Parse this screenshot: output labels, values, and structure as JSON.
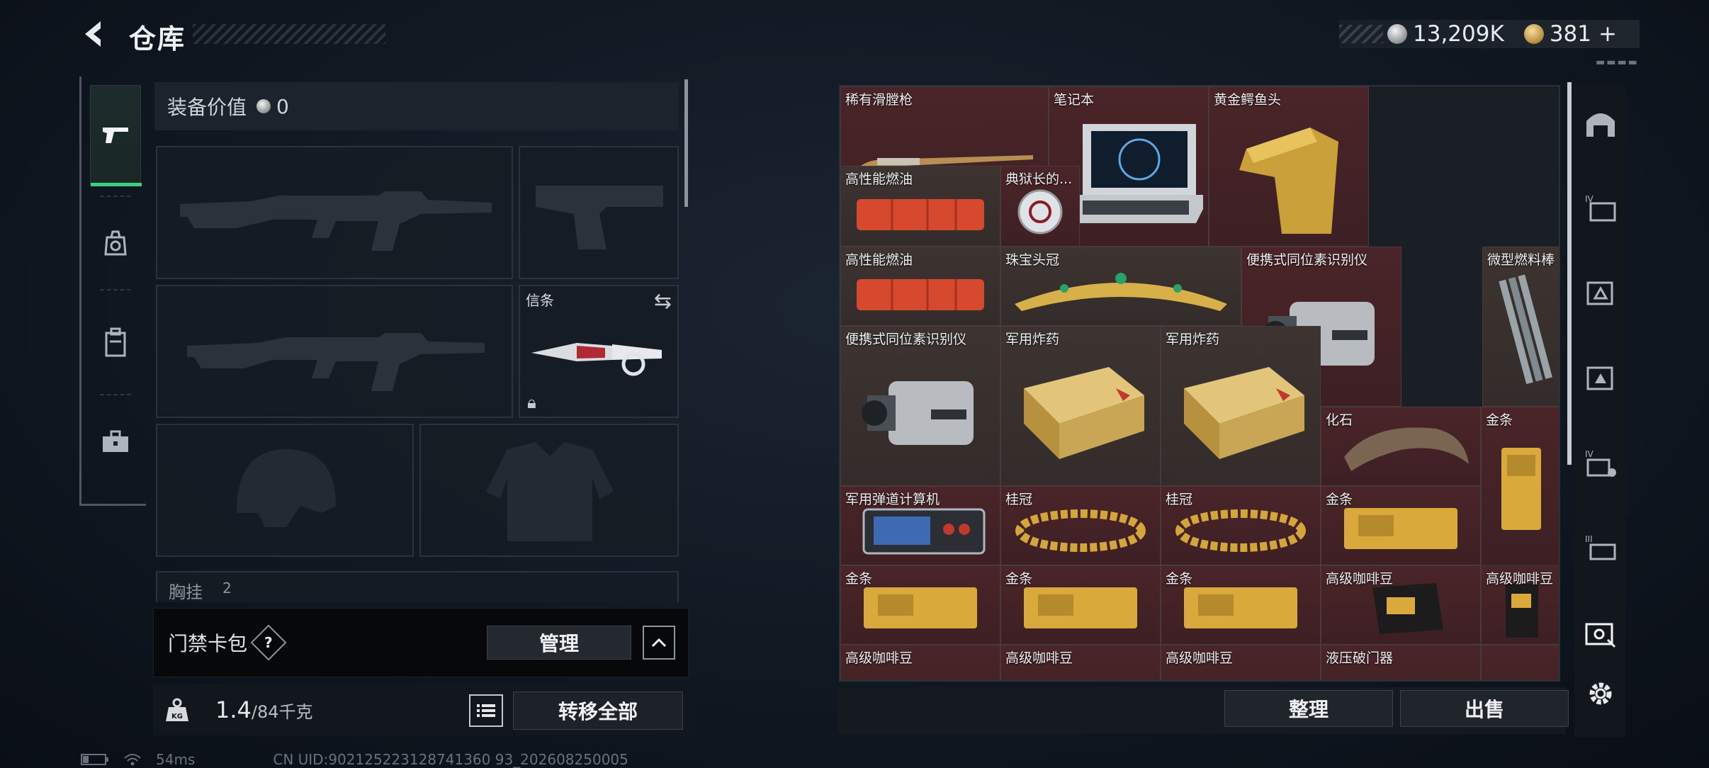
{
  "header": {
    "title": "仓库",
    "currency": {
      "silver_value": "13,209K",
      "gold_value": "381",
      "gold_plus": "+"
    }
  },
  "sidebar": {
    "tabs": [
      {
        "name": "weapons",
        "icon": "pistol-icon",
        "active": true
      },
      {
        "name": "equipment",
        "icon": "helmet-crate-icon",
        "active": false
      },
      {
        "name": "backpack",
        "icon": "backpack-icon",
        "active": false
      },
      {
        "name": "toolbox",
        "icon": "toolbox-icon",
        "active": false
      }
    ]
  },
  "equipment": {
    "value_label": "装备价值",
    "value": "0",
    "melee_slot_label": "信条",
    "chest_label": "胸挂",
    "chest_count": "2"
  },
  "card_pack": {
    "label": "门禁卡包",
    "help": "?",
    "manage_label": "管理",
    "caret": "^"
  },
  "weight": {
    "current": "1.4",
    "max_text": "/84千克",
    "transfer_all_label": "转移全部"
  },
  "status_bar": {
    "ping": "54ms",
    "uid": "CN UID:902125223128741360 93_202608250005"
  },
  "stash": {
    "items": [
      {
        "name": "稀有滑膛枪",
        "rarity": "red",
        "icon": "musket-icon"
      },
      {
        "name": "笔记本",
        "rarity": "red",
        "icon": "laptop-icon"
      },
      {
        "name": "黄金鳄鱼头",
        "rarity": "red",
        "icon": "gold-crocodile-head-icon"
      },
      {
        "name": "高性能燃油",
        "rarity": "brown",
        "icon": "fuel-can-icon"
      },
      {
        "name": "典狱长的...",
        "rarity": "red",
        "icon": "warden-medal-icon"
      },
      {
        "name": "高性能燃油",
        "rarity": "brown",
        "icon": "fuel-can-icon"
      },
      {
        "name": "珠宝头冠",
        "rarity": "brown",
        "icon": "tiara-icon"
      },
      {
        "name": "便携式同位素识别仪",
        "rarity": "red",
        "icon": "isotope-scanner-icon"
      },
      {
        "name": "微型燃料棒",
        "rarity": "brown",
        "icon": "fuel-rod-icon"
      },
      {
        "name": "便携式同位素识别仪",
        "rarity": "brown",
        "icon": "isotope-scanner-icon"
      },
      {
        "name": "军用炸药",
        "rarity": "brown",
        "icon": "explosive-crate-icon"
      },
      {
        "name": "军用炸药",
        "rarity": "brown",
        "icon": "explosive-crate-icon"
      },
      {
        "name": "化石",
        "rarity": "red",
        "icon": "fossil-claw-icon"
      },
      {
        "name": "金条",
        "rarity": "red",
        "icon": "gold-bar-icon"
      },
      {
        "name": "军用弹道计算机",
        "rarity": "red",
        "icon": "ballistic-computer-icon"
      },
      {
        "name": "桂冠",
        "rarity": "red",
        "icon": "laurel-icon"
      },
      {
        "name": "桂冠",
        "rarity": "red",
        "icon": "laurel-icon"
      },
      {
        "name": "金条",
        "rarity": "red",
        "icon": "gold-bar-icon"
      },
      {
        "name": "金条",
        "rarity": "red",
        "icon": "gold-bar-icon"
      },
      {
        "name": "金条",
        "rarity": "red",
        "icon": "gold-bar-icon"
      },
      {
        "name": "金条",
        "rarity": "red",
        "icon": "gold-bar-icon"
      },
      {
        "name": "高级咖啡豆",
        "rarity": "red",
        "icon": "coffee-bag-icon"
      },
      {
        "name": "高级咖啡豆",
        "rarity": "red",
        "icon": "coffee-bag-icon"
      },
      {
        "name": "高级咖啡豆",
        "rarity": "red",
        "icon": "coffee-bag-icon"
      },
      {
        "name": "高级咖啡豆",
        "rarity": "red",
        "icon": "coffee-bag-icon"
      },
      {
        "name": "高级咖啡豆",
        "rarity": "red",
        "icon": "coffee-bag-icon"
      },
      {
        "name": "液压破门器",
        "rarity": "red",
        "icon": "hydraulic-breacher-icon"
      }
    ],
    "sort_label": "整理",
    "sell_label": "出售"
  },
  "right_toolbar": {
    "icons": [
      "bunker-icon",
      "stash-iv-icon",
      "stash-b-icon",
      "stash-c-icon",
      "stash-iv-lock-icon",
      "stash-iii-icon",
      "stash-active-icon",
      "settings-gear-icon"
    ]
  },
  "colors": {
    "red_rarity": "#4a2428",
    "brown_rarity": "#3d3431",
    "active_accent": "#3ad07f"
  }
}
